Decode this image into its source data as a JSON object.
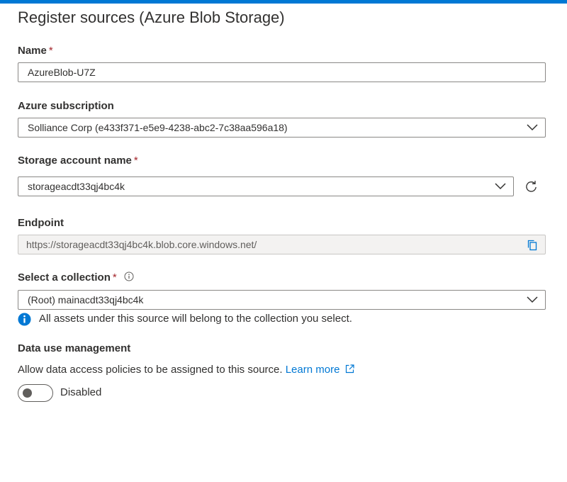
{
  "title": "Register sources (Azure Blob Storage)",
  "required_mark": "*",
  "name": {
    "label": "Name",
    "value": "AzureBlob-U7Z"
  },
  "subscription": {
    "label": "Azure subscription",
    "value": "Solliance Corp (e433f371-e5e9-4238-abc2-7c38aa596a18)"
  },
  "storage": {
    "label": "Storage account name",
    "value": "storageacdt33qj4bc4k"
  },
  "endpoint": {
    "label": "Endpoint",
    "value": "https://storageacdt33qj4bc4k.blob.core.windows.net/"
  },
  "collection": {
    "label": "Select a collection",
    "value": "(Root) mainacdt33qj4bc4k",
    "info": "All assets under this source will belong to the collection you select."
  },
  "data_use": {
    "label": "Data use management",
    "description": "Allow data access policies to be assigned to this source.",
    "learn_more": "Learn more",
    "toggle_label": "Disabled",
    "enabled": false
  },
  "colors": {
    "accent": "#0078d4",
    "required": "#a4262c",
    "border": "#8a8886",
    "disabled_bg": "#f3f2f1"
  },
  "icons": [
    "chevron-down-icon",
    "refresh-icon",
    "copy-icon",
    "info-circle-icon",
    "info-filled-icon",
    "external-link-icon"
  ]
}
